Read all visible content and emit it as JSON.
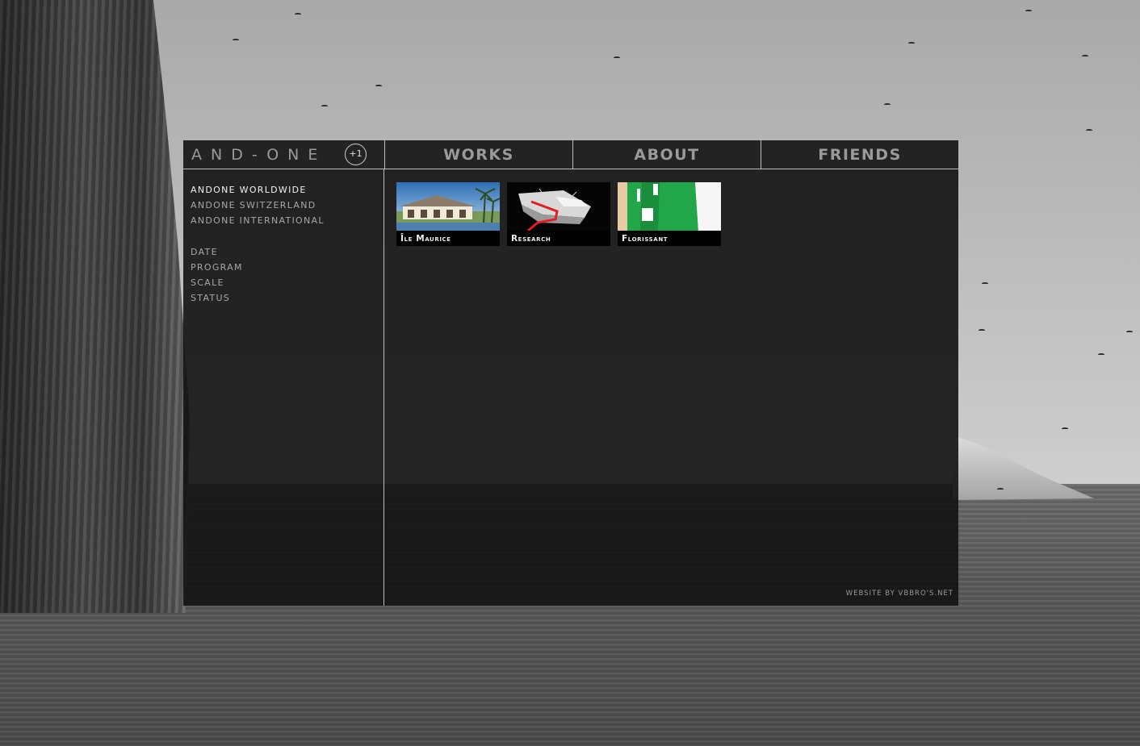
{
  "logo": {
    "text": "AND-ONE",
    "badge": "+1"
  },
  "nav": {
    "works": "WORKS",
    "about": "ABOUT",
    "friends": "FRIENDS"
  },
  "sidebar": {
    "regions": [
      "ANDONE WORLDWIDE",
      "ANDONE SWITZERLAND",
      "ANDONE INTERNATIONAL"
    ],
    "active_region": "ANDONE WORLDWIDE",
    "filters": [
      "DATE",
      "PROGRAM",
      "SCALE",
      "STATUS"
    ]
  },
  "works": [
    {
      "title": "Île Maurice"
    },
    {
      "title": "Research"
    },
    {
      "title": "Florissant"
    }
  ],
  "footer": {
    "credit": "website by vbbro's.net"
  }
}
